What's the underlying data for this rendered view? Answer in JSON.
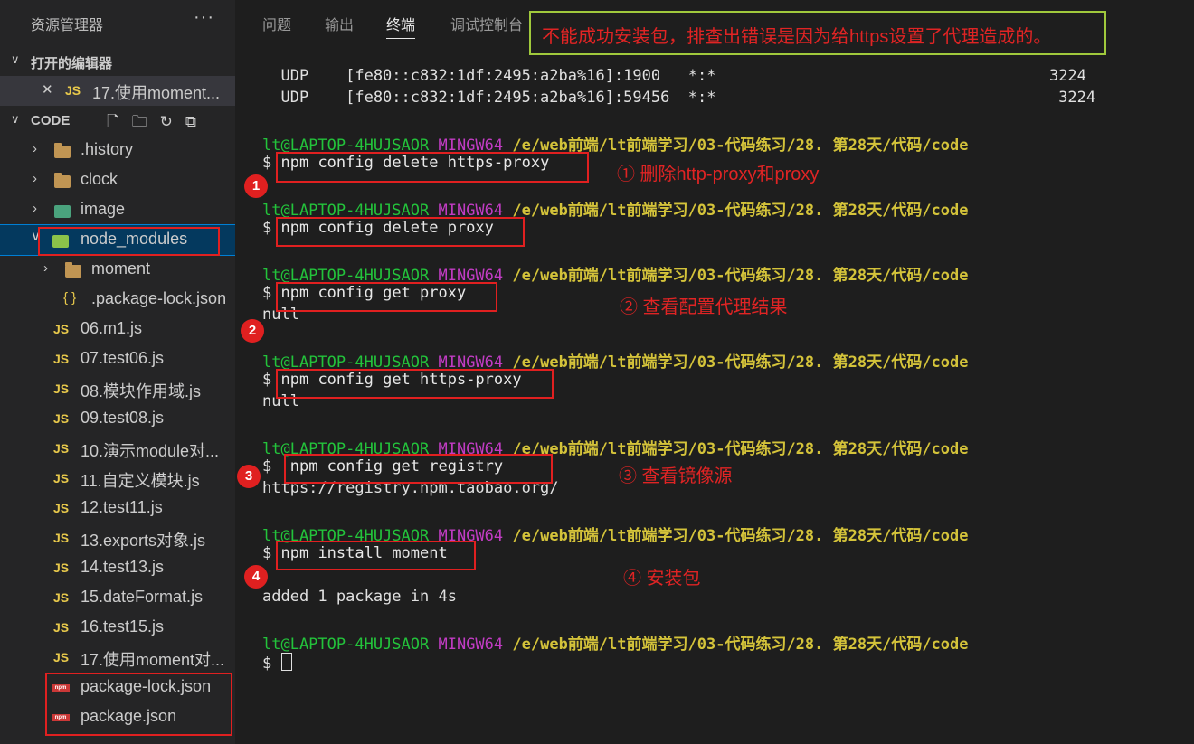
{
  "explorer": {
    "title": "资源管理器",
    "more": "···",
    "open_editors": {
      "label": "打开的编辑器",
      "items": [
        {
          "close": "✕",
          "icon": "JS",
          "name": "17.使用moment..."
        }
      ]
    },
    "workspace": {
      "label": "CODE"
    },
    "tree": [
      {
        "name": ".history",
        "type": "folder"
      },
      {
        "name": "clock",
        "type": "folder"
      },
      {
        "name": "image",
        "type": "image-folder"
      },
      {
        "name": "node_modules",
        "type": "node-folder"
      },
      {
        "name": "moment",
        "type": "folder"
      },
      {
        "name": ".package-lock.json",
        "type": "json",
        "icon": "{ }"
      },
      {
        "name": "06.m1.js",
        "type": "js",
        "icon": "JS"
      },
      {
        "name": "07.test06.js",
        "type": "js",
        "icon": "JS"
      },
      {
        "name": "08.模块作用域.js",
        "type": "js",
        "icon": "JS"
      },
      {
        "name": "09.test08.js",
        "type": "js",
        "icon": "JS"
      },
      {
        "name": "10.演示module对...",
        "type": "js",
        "icon": "JS"
      },
      {
        "name": "11.自定义模块.js",
        "type": "js",
        "icon": "JS"
      },
      {
        "name": "12.test11.js",
        "type": "js",
        "icon": "JS"
      },
      {
        "name": "13.exports对象.js",
        "type": "js",
        "icon": "JS"
      },
      {
        "name": "14.test13.js",
        "type": "js",
        "icon": "JS"
      },
      {
        "name": "15.dateFormat.js",
        "type": "js",
        "icon": "JS"
      },
      {
        "name": "16.test15.js",
        "type": "js",
        "icon": "JS"
      },
      {
        "name": "17.使用moment对...",
        "type": "js",
        "icon": "JS"
      },
      {
        "name": "package-lock.json",
        "type": "npm",
        "icon": "npm"
      },
      {
        "name": "package.json",
        "type": "npm",
        "icon": "npm"
      }
    ]
  },
  "panel_tabs": [
    "问题",
    "输出",
    "终端",
    "调试控制台"
  ],
  "active_tab": "终端",
  "banner": "不能成功安装包，排查出错误是因为给https设置了代理造成的。",
  "terminal": {
    "udp1": "  UDP    [fe80::c832:1df:2495:a2ba%16]:1900   *:*                                    3224",
    "udp2": "  UDP    [fe80::c832:1df:2495:a2ba%16]:59456  *:*                                     3224",
    "user": "lt@LAPTOP-4HUJSAOR",
    "shell": "MINGW64",
    "path": "/e/web前端/lt前端学习/03-代码练习/28. 第28天/代码/code",
    "prompt": "$",
    "commands": [
      "npm config delete https-proxy",
      "npm config delete proxy",
      "npm config get proxy",
      "npm config get https-proxy",
      " npm config get registry",
      "npm install moment"
    ],
    "outputs": {
      "proxy": "null",
      "https_proxy": "null",
      "registry": "https://registry.npm.taobao.org/",
      "install": "added 1 package in 4s"
    }
  },
  "annotations": {
    "step1": "① 删除http-proxy和proxy",
    "step2": "② 查看配置代理结果",
    "step3": "③ 查看镜像源",
    "step4": "④ 安装包",
    "n1": "1",
    "n2": "2",
    "n3": "3",
    "n4": "4"
  }
}
